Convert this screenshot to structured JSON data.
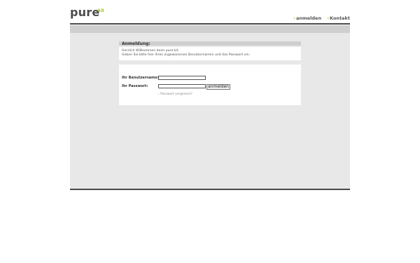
{
  "header": {
    "logo_text": "pure",
    "logo_superscript": "kit",
    "nav": [
      {
        "arrow": "›",
        "label": "anmelden"
      },
      {
        "arrow": "›",
        "label": "Kontakt"
      }
    ]
  },
  "login_box": {
    "title": "Anmeldung:",
    "intro_line1": "Herzlich Willkommen beim pure-kit.",
    "intro_line2": "Geben Sie bitte hier Ihren zugewiesenen Benutzernamen und das Passwort ein.",
    "username_label": "Ihr Benutzername:",
    "username_value": "",
    "password_label": "Ihr Passwort:",
    "password_value": "",
    "submit_label": "anmelden",
    "forgot_link": "› Passwort vergessen?"
  },
  "colors": {
    "accent": "#9bc31c",
    "dark_bar": "#4a4a4a",
    "content_bg": "#e8e8e8"
  }
}
